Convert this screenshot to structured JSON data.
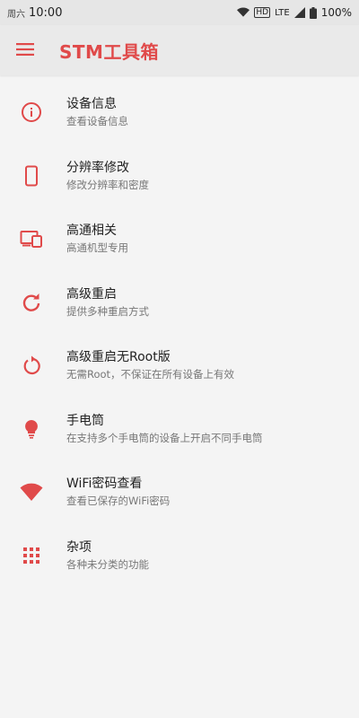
{
  "status_bar": {
    "carrier": "周六",
    "time": "10:00",
    "network": "LTE",
    "battery": "100%",
    "icons": [
      "wifi-icon",
      "hd-icon",
      "signal-icon",
      "battery-icon"
    ]
  },
  "app_bar": {
    "title": "STM工具箱",
    "menu_icon": "hamburger-menu-icon"
  },
  "colors": {
    "accent": "#e04a4a",
    "title_text": "#222222",
    "subtitle_text": "#777777",
    "background": "#f4f4f4",
    "app_bar_bg": "#eaeaea"
  },
  "menu": {
    "items": [
      {
        "title": "设备信息",
        "subtitle": "查看设备信息",
        "icon": "info-icon"
      },
      {
        "title": "分辨率修改",
        "subtitle": "修改分辨率和密度",
        "icon": "phone-icon"
      },
      {
        "title": "高通相关",
        "subtitle": "高通机型专用",
        "icon": "devices-icon"
      },
      {
        "title": "高级重启",
        "subtitle": "提供多种重启方式",
        "icon": "refresh-icon"
      },
      {
        "title": "高级重启无Root版",
        "subtitle": "无需Root，不保证在所有设备上有效",
        "icon": "restart-icon"
      },
      {
        "title": "手电筒",
        "subtitle": "在支持多个手电筒的设备上开启不同手电筒",
        "icon": "lightbulb-icon"
      },
      {
        "title": "WiFi密码查看",
        "subtitle": "查看已保存的WiFi密码",
        "icon": "wifi-icon"
      },
      {
        "title": "杂项",
        "subtitle": "各种未分类的功能",
        "icon": "apps-grid-icon"
      }
    ]
  }
}
